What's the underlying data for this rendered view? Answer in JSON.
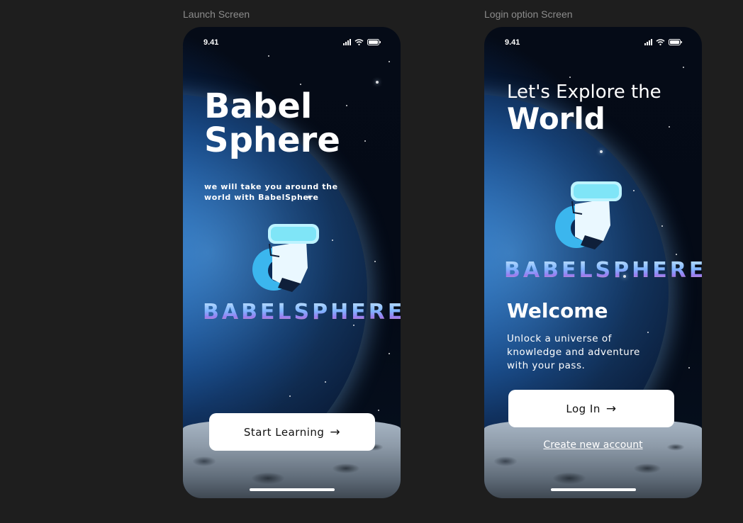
{
  "frames": {
    "launch_label": "Launch Screen",
    "login_label": "Login option  Screen"
  },
  "launch": {
    "time": "9.41",
    "title_line1": "Babel",
    "title_line2": "Sphere",
    "subtitle_line1": "we will take you around the",
    "subtitle_line2": "world with BabelSphere",
    "brand": "BABELSPHERE",
    "start_label": "Start Learning",
    "arrow": "→"
  },
  "login": {
    "time": "9.41",
    "title_line1": "Let's Explore the",
    "title_line2": "World",
    "brand": "BABELSPHERE",
    "welcome": "Welcome",
    "tagline_line1": "Unlock a universe of",
    "tagline_line2": "knowledge and adventure",
    "tagline_line3": "with your pass.",
    "login_label": "Log In",
    "arrow": "→",
    "create_account": "Create new account"
  },
  "icons": [
    "cellular-signal-icon",
    "wifi-icon",
    "battery-icon",
    "arrow-right-icon",
    "vr-headset-mascot-icon"
  ],
  "colors": {
    "canvas": "#1e1e1e",
    "button": "#ffffff",
    "space": "#050b17"
  }
}
